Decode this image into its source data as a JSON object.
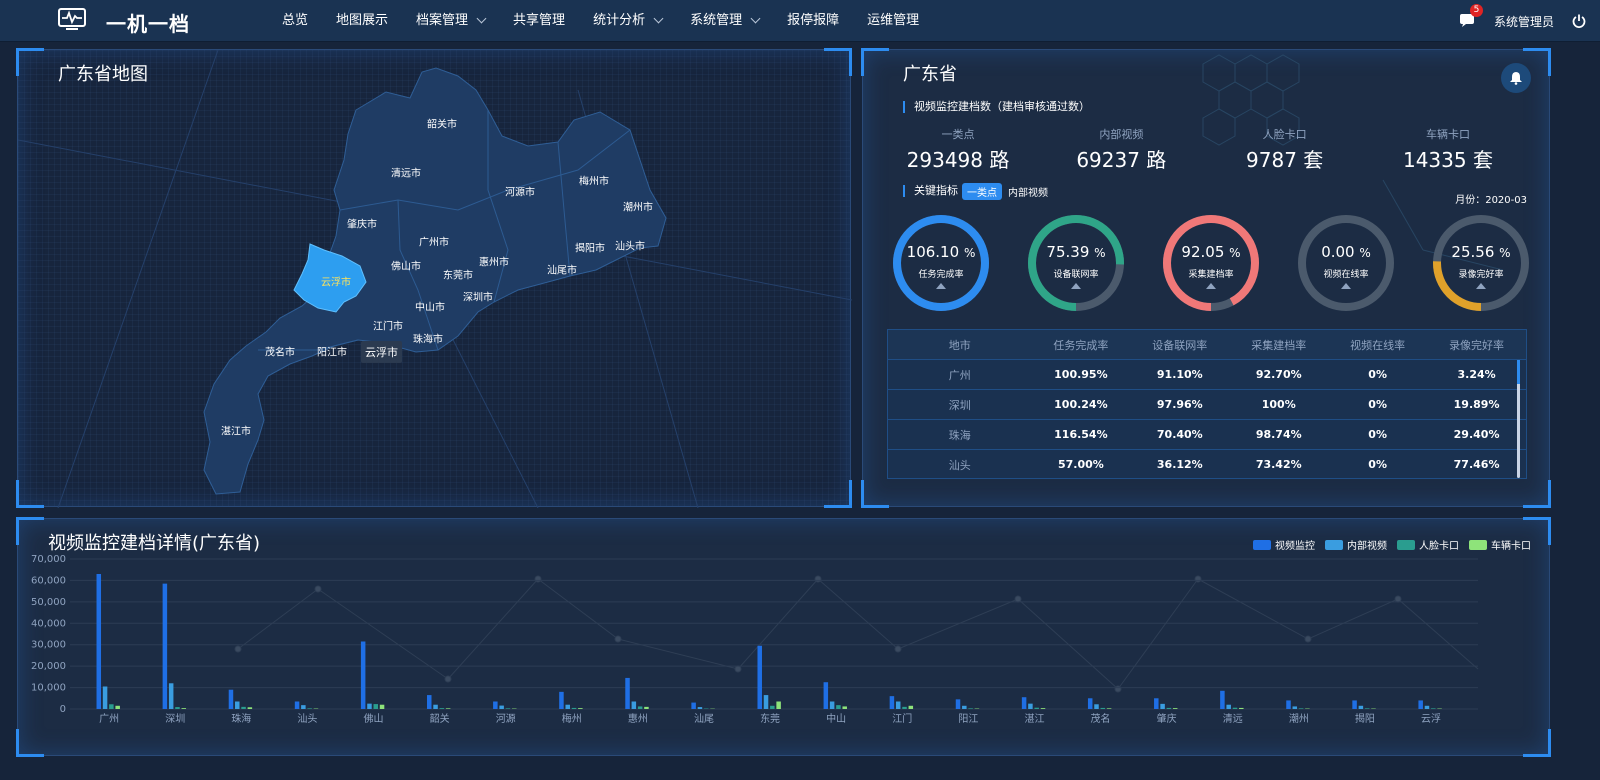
{
  "header": {
    "brand": "一机一档",
    "nav": [
      {
        "label": "总览",
        "dropdown": false
      },
      {
        "label": "地图展示",
        "dropdown": false
      },
      {
        "label": "档案管理",
        "dropdown": true
      },
      {
        "label": "共享管理",
        "dropdown": false
      },
      {
        "label": "统计分析",
        "dropdown": true
      },
      {
        "label": "系统管理",
        "dropdown": true
      },
      {
        "label": "报停报障",
        "dropdown": false
      },
      {
        "label": "运维管理",
        "dropdown": false
      }
    ],
    "message_count": "5",
    "user": "系统管理员",
    "icons": {
      "logo": "monitor-pulse-icon",
      "messages": "chat-icon",
      "power": "power-icon"
    }
  },
  "map": {
    "title": "广东省地图",
    "selected_city": "云浮市",
    "tooltip": "云浮市",
    "cities": [
      "韶关市",
      "清远市",
      "河源市",
      "梅州市",
      "潮州市",
      "肇庆市",
      "广州市",
      "揭阳市",
      "汕头市",
      "云浮市",
      "佛山市",
      "惠州市",
      "东莞市",
      "汕尾市",
      "深圳市",
      "中山市",
      "江门市",
      "珠海市",
      "茂名市",
      "阳江市",
      "湛江市"
    ]
  },
  "province": {
    "title": "广东省",
    "archive_section": "视频监控建档数（建档审核通过数）",
    "stats": [
      {
        "label": "一类点",
        "value": "293498 路"
      },
      {
        "label": "内部视频",
        "value": "69237 路"
      },
      {
        "label": "人脸卡口",
        "value": "9787 套"
      },
      {
        "label": "车辆卡口",
        "value": "14335 套"
      }
    ],
    "kpi_section": "关键指标",
    "kpi_tab_active": "一类点",
    "kpi_tab_other": "内部视频",
    "month": "月份：2020-03",
    "gauges": [
      {
        "value": "106.10",
        "unit": "%",
        "label": "任务完成率",
        "fraction": 1.0,
        "color": "#2d8cf0"
      },
      {
        "value": "75.39",
        "unit": "%",
        "label": "设备联网率",
        "fraction": 0.7539,
        "color": "#2fa588"
      },
      {
        "value": "92.05",
        "unit": "%",
        "label": "采集建档率",
        "fraction": 0.9205,
        "color": "#f07878"
      },
      {
        "value": "0.00",
        "unit": "%",
        "label": "视频在线率",
        "fraction": 0.0,
        "color": "#2d8cf0"
      },
      {
        "value": "25.56",
        "unit": "%",
        "label": "录像完好率",
        "fraction": 0.2556,
        "color": "#e0a12a"
      }
    ],
    "table": {
      "headers": [
        "地市",
        "任务完成率",
        "设备联网率",
        "采集建档率",
        "视频在线率",
        "录像完好率"
      ],
      "rows": [
        [
          "广州",
          "100.95%",
          "91.10%",
          "92.70%",
          "0%",
          "3.24%"
        ],
        [
          "深圳",
          "100.24%",
          "97.96%",
          "100%",
          "0%",
          "19.89%"
        ],
        [
          "珠海",
          "116.54%",
          "70.40%",
          "98.74%",
          "0%",
          "29.40%"
        ],
        [
          "汕头",
          "57.00%",
          "36.12%",
          "73.42%",
          "0%",
          "77.46%"
        ]
      ]
    }
  },
  "chart_section": {
    "title": "视频监控建档详情(广东省)"
  },
  "chart_data": {
    "type": "bar",
    "categories": [
      "广州",
      "深圳",
      "珠海",
      "汕头",
      "佛山",
      "韶关",
      "河源",
      "梅州",
      "惠州",
      "汕尾",
      "东莞",
      "中山",
      "江门",
      "阳江",
      "湛江",
      "茂名",
      "肇庆",
      "清远",
      "潮州",
      "揭阳",
      "云浮"
    ],
    "series": [
      {
        "name": "视频监控",
        "color": "#1f6fe5",
        "values": [
          63000,
          58500,
          9000,
          3500,
          31500,
          6500,
          3500,
          8000,
          14500,
          3000,
          29500,
          12500,
          6000,
          4500,
          5500,
          5000,
          5000,
          8500,
          4000,
          4000,
          4000
        ]
      },
      {
        "name": "内部视频",
        "color": "#3a9de0",
        "values": [
          10500,
          12000,
          3500,
          1800,
          2500,
          2000,
          1600,
          2000,
          3500,
          900,
          6500,
          3500,
          3500,
          1500,
          2500,
          2200,
          2400,
          2000,
          1200,
          1500,
          1500
        ]
      },
      {
        "name": "人脸卡口",
        "color": "#2a9d8f",
        "values": [
          2200,
          900,
          1000,
          300,
          2300,
          400,
          300,
          500,
          1200,
          200,
          1500,
          1800,
          1000,
          300,
          600,
          500,
          500,
          600,
          300,
          300,
          300
        ]
      },
      {
        "name": "车辆卡口",
        "color": "#8ee37a",
        "values": [
          1500,
          400,
          800,
          200,
          2000,
          300,
          200,
          400,
          1000,
          150,
          3500,
          1200,
          1500,
          200,
          400,
          300,
          400,
          500,
          200,
          200,
          200
        ]
      }
    ],
    "yticks": [
      "0",
      "10,000",
      "20,000",
      "30,000",
      "40,000",
      "50,000",
      "60,000",
      "70,000"
    ],
    "ylim": [
      0,
      70000
    ]
  }
}
